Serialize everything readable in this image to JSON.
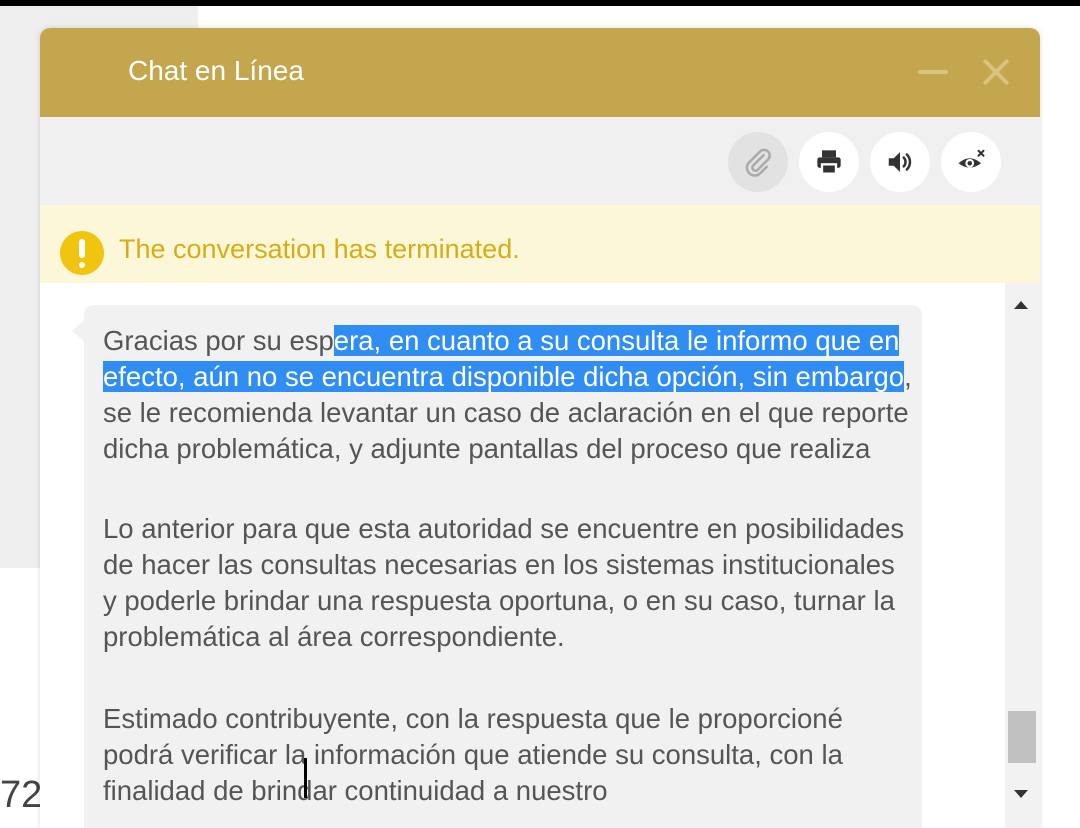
{
  "background": {
    "number_fragment": "72"
  },
  "chat": {
    "title": "Chat en Línea",
    "toolbar": {
      "buttons": [
        {
          "name": "attach",
          "icon": "paperclip-icon",
          "enabled": false
        },
        {
          "name": "print",
          "icon": "printer-icon",
          "enabled": true
        },
        {
          "name": "sound",
          "icon": "speaker-icon",
          "enabled": true
        },
        {
          "name": "visibility",
          "icon": "eye-slash-icon",
          "enabled": true
        }
      ]
    },
    "alert": {
      "text": "The conversation has terminated.",
      "icon": "exclamation-circle-icon",
      "color": "#d6ad13"
    },
    "message": {
      "p1": {
        "before": "Gracias por su esp",
        "selected": "era, en cuanto a su consulta le informo que en efecto, aún no se encuentra disponible dicha opción, sin embargo",
        "after": ", se le recomienda levantar un caso de aclaración en el que reporte dicha problemática, y adjunte pantallas del proceso que realiza"
      },
      "p2": "Lo anterior para que esta autoridad se encuentre en posibilidades de hacer las consultas necesarias en los sistemas institucionales y poderle brindar una respuesta oportuna, o en su caso, turnar la problemática al área correspondiente.",
      "p3": "Estimado contribuyente, con la respuesta que le proporcioné podrá verificar la información que atiende su consulta, con la finalidad de brindar continuidad a nuestro"
    },
    "colors": {
      "header": "#c4a64e",
      "selection": "#2f8df4",
      "alert_bg": "#fcf7d8"
    }
  }
}
